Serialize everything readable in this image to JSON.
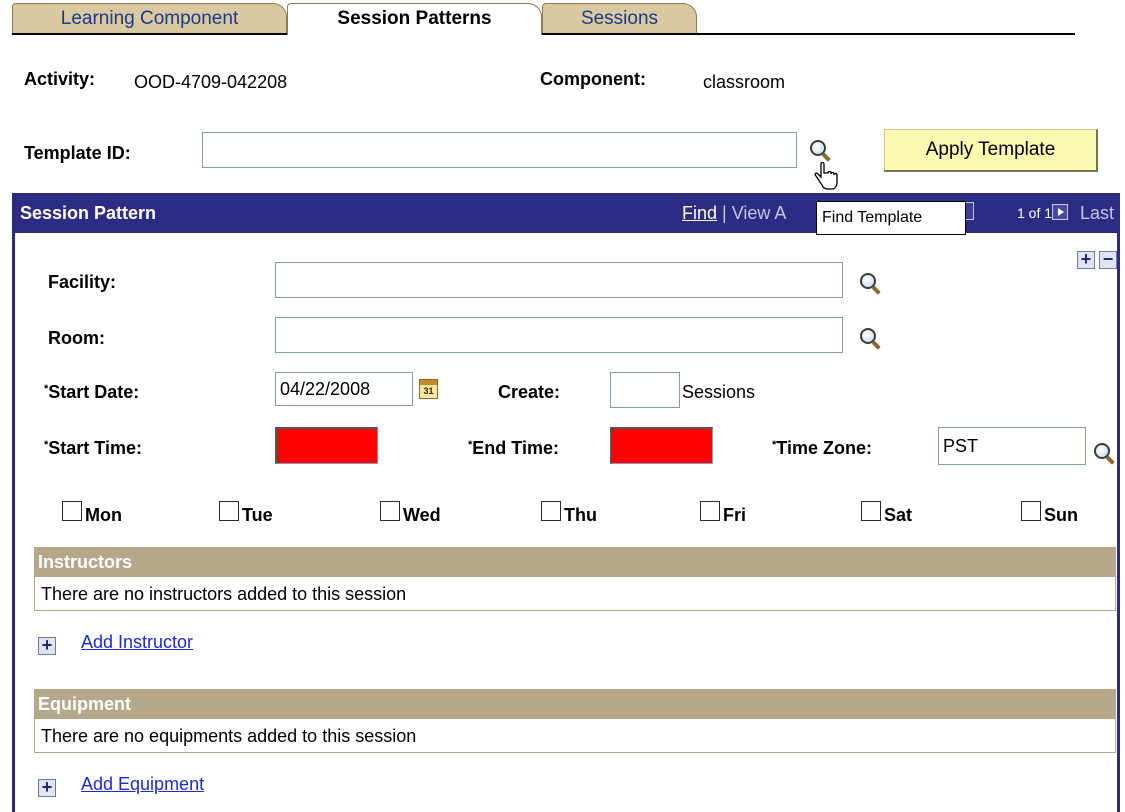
{
  "tabs": [
    {
      "label": "Learning Component",
      "active": false
    },
    {
      "label": "Session Patterns",
      "active": true
    },
    {
      "label": "Sessions",
      "active": false
    }
  ],
  "header": {
    "activity_label": "Activity:",
    "activity_value": "OOD-4709-042208",
    "component_label": "Component:",
    "component_value": "classroom"
  },
  "template": {
    "label": "Template ID:",
    "value": "",
    "lookup_icon": "magnifier-icon",
    "apply_button": "Apply Template",
    "tooltip": "Find Template"
  },
  "session_pattern": {
    "title": "Session Pattern",
    "nav_find": "Find",
    "nav_separator": "|",
    "nav_view": "View A",
    "counter": "1 of 1",
    "nav_last": "Last",
    "facility_label": "Facility:",
    "facility_value": "",
    "room_label": "Room:",
    "room_value": "",
    "start_date_label": "Start Date:",
    "start_date_value": "04/22/2008",
    "calendar_text": "31",
    "create_label": "Create:",
    "create_value": "",
    "sessions_label": "Sessions",
    "start_time_label": "Start Time:",
    "end_time_label": "End Time:",
    "time_zone_label": "Time Zone:",
    "time_zone_value": "PST",
    "required_marker": "*",
    "error_color": "#ff0000",
    "days": [
      "Mon",
      "Tue",
      "Wed",
      "Thu",
      "Fri",
      "Sat",
      "Sun"
    ]
  },
  "instructors": {
    "title": "Instructors",
    "empty_text": "There are no instructors added to this session",
    "add_link": "Add Instructor"
  },
  "equipment": {
    "title": "Equipment",
    "empty_text": "There are no equipments added to this session",
    "add_link": "Add Equipment"
  },
  "colors": {
    "panel_header": "#2c2c84",
    "sub_header": "#b5a78a",
    "tab_inactive": "#d9c8a0",
    "button_bg": "#fbf8b0",
    "link": "#1a2ad8"
  }
}
